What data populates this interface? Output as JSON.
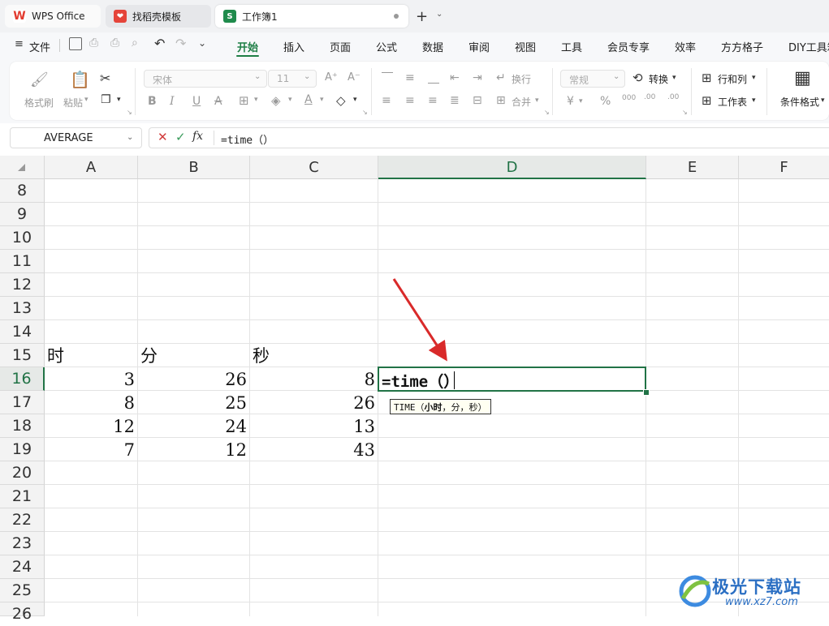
{
  "tabs": [
    {
      "label": "WPS Office",
      "icon": "wps-logo-icon"
    },
    {
      "label": "找稻壳模板",
      "icon": "docer-icon"
    },
    {
      "label": "工作簿1",
      "icon": "spreadsheet-s-icon"
    }
  ],
  "menu": {
    "file": "文件",
    "items": [
      "开始",
      "插入",
      "页面",
      "公式",
      "数据",
      "审阅",
      "视图",
      "工具",
      "会员专享",
      "效率",
      "方方格子",
      "DIY工具箱"
    ],
    "active": "开始"
  },
  "ribbon": {
    "format_painter": "格式刷",
    "paste": "粘贴",
    "font_name": "宋体",
    "font_size": "11",
    "wrap": "换行",
    "merge": "合并",
    "number_format": "常规",
    "convert": "转换",
    "rows_cols": "行和列",
    "worksheet": "工作表",
    "cond_format": "条件格式"
  },
  "formula_bar": {
    "name_box": "AVERAGE",
    "formula": "=time（）"
  },
  "columns": [
    "A",
    "B",
    "C",
    "D",
    "E",
    "F"
  ],
  "rows": [
    "8",
    "9",
    "10",
    "11",
    "12",
    "13",
    "14",
    "15",
    "16",
    "17",
    "18",
    "19",
    "20",
    "21",
    "22",
    "23",
    "24",
    "25",
    "26"
  ],
  "cells": {
    "A15": "时",
    "B15": "分",
    "C15": "秒",
    "A16": "3",
    "B16": "26",
    "C16": "8",
    "A17": "8",
    "B17": "25",
    "C17": "26",
    "A18": "12",
    "B18": "24",
    "C18": "13",
    "A19": "7",
    "B19": "12",
    "C19": "43"
  },
  "active_cell": {
    "ref": "D16",
    "text": "=time（）"
  },
  "tooltip": {
    "fn": "TIME（",
    "args": "小时",
    "rest": "，分，秒）"
  },
  "watermark": {
    "name": "极光下载站",
    "url": "www.xz7.com"
  },
  "colors": {
    "accent": "#217346",
    "arrow": "#d92a2a"
  }
}
